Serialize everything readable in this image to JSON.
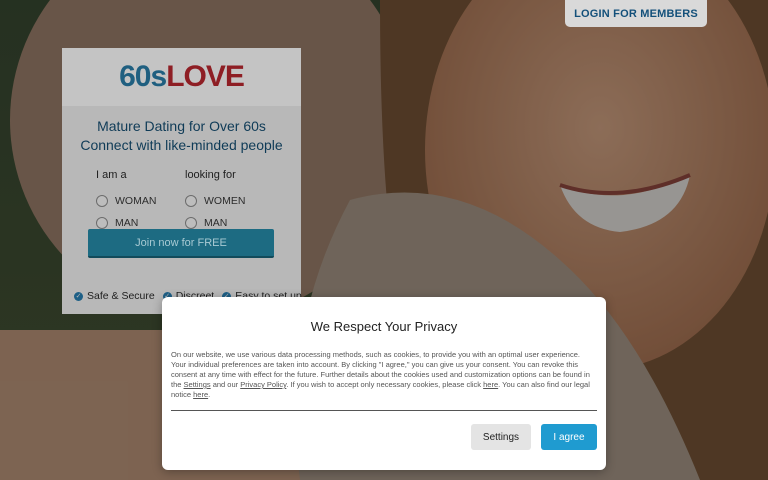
{
  "header": {
    "login_label": "LOGIN FOR MEMBERS"
  },
  "signup": {
    "logo_number": "60s",
    "logo_word": "LOVE",
    "tagline_1": "Mature Dating for Over 60s",
    "tagline_2": "Connect with like-minded people",
    "i_am_label": "I am a",
    "looking_label": "looking for",
    "i_am_options": [
      "WOMAN",
      "MAN"
    ],
    "looking_options": [
      "WOMEN",
      "MAN"
    ],
    "join_label": "Join now for FREE",
    "features": [
      "Safe & Secure",
      "Discreet",
      "Easy to set up"
    ]
  },
  "privacy": {
    "title": "We Respect Your Privacy",
    "body_1": "On our website, we use various data processing methods, such as cookies, to provide you with an optimal user experience. Your individual preferences are taken into account. By clicking \"I agree,\" you can give us your consent. You can revoke this consent at any time with effect for the future. Further details about the cookies used and customization options can be found in the ",
    "settings_link": "Settings",
    "body_2": " and our ",
    "policy_link": "Privacy Policy",
    "body_3": ". If you wish to accept only necessary cookies, please click ",
    "here_link_1": "here",
    "body_4": ". You can also find our legal notice ",
    "here_link_2": "here",
    "body_5": ".",
    "settings_button": "Settings",
    "agree_button": "I agree"
  },
  "colors": {
    "accent": "#1f9bd0",
    "join": "#1d6b82",
    "logo_blue": "#1f5f80",
    "logo_red": "#8e1e24"
  }
}
